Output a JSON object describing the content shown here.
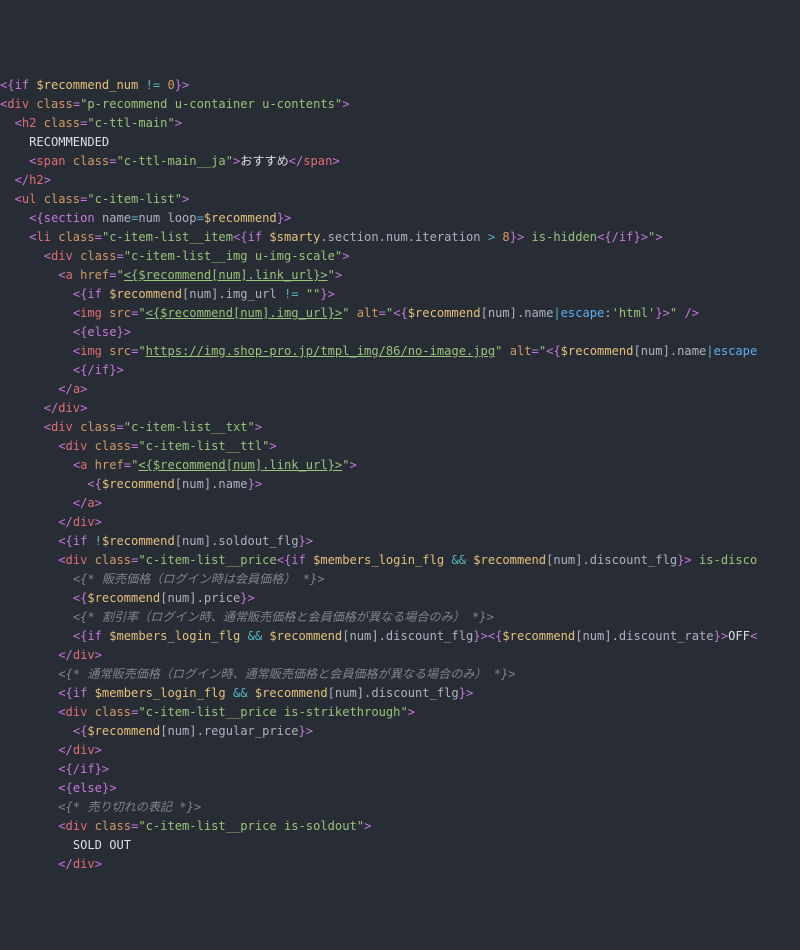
{
  "language": "smarty-html",
  "lines": [
    "<{if $recommend_num != 0}>",
    "<div class=\"p-recommend u-container u-contents\">",
    "  <h2 class=\"c-ttl-main\">",
    "    RECOMMENDED",
    "    <span class=\"c-ttl-main__ja\">おすすめ</span>",
    "  </h2>",
    "  <ul class=\"c-item-list\">",
    "    <{section name=num loop=$recommend}>",
    "    <li class=\"c-item-list__item<{if $smarty.section.num.iteration > 8}> is-hidden<{/if}>\">",
    "      <div class=\"c-item-list__img u-img-scale\">",
    "        <a href=\"<{$recommend[num].link_url}>\">",
    "          <{if $recommend[num].img_url != \"\"}>",
    "          <img src=\"<{$recommend[num].img_url}>\" alt=\"<{$recommend[num].name|escape:'html'}>\" />",
    "          <{else}>",
    "          <img src=\"https://img.shop-pro.jp/tmpl_img/86/no-image.jpg\" alt=\"<{$recommend[num].name|escape",
    "          <{/if}>",
    "        </a>",
    "      </div>",
    "      <div class=\"c-item-list__txt\">",
    "        <div class=\"c-item-list__ttl\">",
    "          <a href=\"<{$recommend[num].link_url}>\">",
    "            <{$recommend[num].name}>",
    "          </a>",
    "        </div>",
    "        <{if !$recommend[num].soldout_flg}>",
    "        <div class=\"c-item-list__price<{if $members_login_flg && $recommend[num].discount_flg}> is-disco",
    "          <{* 販売価格（ログイン時は会員価格） *}>",
    "          <{$recommend[num].price}>",
    "          <{* 割引率（ログイン時、通常販売価格と会員価格が異なる場合のみ） *}>",
    "          <{if $members_login_flg && $recommend[num].discount_flg}><{$recommend[num].discount_rate}>OFF<",
    "        </div>",
    "        <{* 通常販売価格（ログイン時、通常販売価格と会員価格が異なる場合のみ） *}>",
    "        <{if $members_login_flg && $recommend[num].discount_flg}>",
    "        <div class=\"c-item-list__price is-strikethrough\">",
    "          <{$recommend[num].regular_price}>",
    "        </div>",
    "        <{/if}>",
    "        <{else}>",
    "        <{* 売り切れの表記 *}>",
    "        <div class=\"c-item-list__price is-soldout\">",
    "          SOLD OUT",
    "        </div>"
  ]
}
